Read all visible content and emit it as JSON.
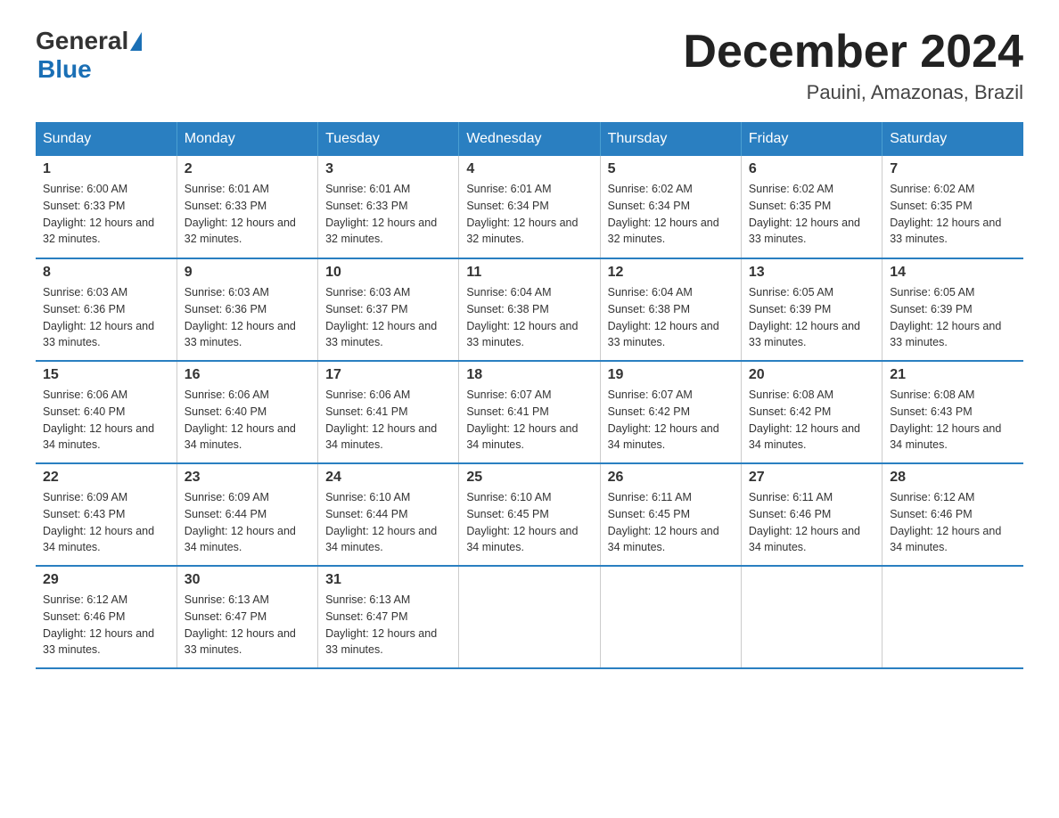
{
  "logo": {
    "general": "General",
    "blue": "Blue",
    "underline": "Blue"
  },
  "header": {
    "month_title": "December 2024",
    "location": "Pauini, Amazonas, Brazil"
  },
  "weekdays": [
    "Sunday",
    "Monday",
    "Tuesday",
    "Wednesday",
    "Thursday",
    "Friday",
    "Saturday"
  ],
  "weeks": [
    [
      {
        "day": "1",
        "sunrise": "6:00 AM",
        "sunset": "6:33 PM",
        "daylight": "12 hours and 32 minutes."
      },
      {
        "day": "2",
        "sunrise": "6:01 AM",
        "sunset": "6:33 PM",
        "daylight": "12 hours and 32 minutes."
      },
      {
        "day": "3",
        "sunrise": "6:01 AM",
        "sunset": "6:33 PM",
        "daylight": "12 hours and 32 minutes."
      },
      {
        "day": "4",
        "sunrise": "6:01 AM",
        "sunset": "6:34 PM",
        "daylight": "12 hours and 32 minutes."
      },
      {
        "day": "5",
        "sunrise": "6:02 AM",
        "sunset": "6:34 PM",
        "daylight": "12 hours and 32 minutes."
      },
      {
        "day": "6",
        "sunrise": "6:02 AM",
        "sunset": "6:35 PM",
        "daylight": "12 hours and 33 minutes."
      },
      {
        "day": "7",
        "sunrise": "6:02 AM",
        "sunset": "6:35 PM",
        "daylight": "12 hours and 33 minutes."
      }
    ],
    [
      {
        "day": "8",
        "sunrise": "6:03 AM",
        "sunset": "6:36 PM",
        "daylight": "12 hours and 33 minutes."
      },
      {
        "day": "9",
        "sunrise": "6:03 AM",
        "sunset": "6:36 PM",
        "daylight": "12 hours and 33 minutes."
      },
      {
        "day": "10",
        "sunrise": "6:03 AM",
        "sunset": "6:37 PM",
        "daylight": "12 hours and 33 minutes."
      },
      {
        "day": "11",
        "sunrise": "6:04 AM",
        "sunset": "6:38 PM",
        "daylight": "12 hours and 33 minutes."
      },
      {
        "day": "12",
        "sunrise": "6:04 AM",
        "sunset": "6:38 PM",
        "daylight": "12 hours and 33 minutes."
      },
      {
        "day": "13",
        "sunrise": "6:05 AM",
        "sunset": "6:39 PM",
        "daylight": "12 hours and 33 minutes."
      },
      {
        "day": "14",
        "sunrise": "6:05 AM",
        "sunset": "6:39 PM",
        "daylight": "12 hours and 33 minutes."
      }
    ],
    [
      {
        "day": "15",
        "sunrise": "6:06 AM",
        "sunset": "6:40 PM",
        "daylight": "12 hours and 34 minutes."
      },
      {
        "day": "16",
        "sunrise": "6:06 AM",
        "sunset": "6:40 PM",
        "daylight": "12 hours and 34 minutes."
      },
      {
        "day": "17",
        "sunrise": "6:06 AM",
        "sunset": "6:41 PM",
        "daylight": "12 hours and 34 minutes."
      },
      {
        "day": "18",
        "sunrise": "6:07 AM",
        "sunset": "6:41 PM",
        "daylight": "12 hours and 34 minutes."
      },
      {
        "day": "19",
        "sunrise": "6:07 AM",
        "sunset": "6:42 PM",
        "daylight": "12 hours and 34 minutes."
      },
      {
        "day": "20",
        "sunrise": "6:08 AM",
        "sunset": "6:42 PM",
        "daylight": "12 hours and 34 minutes."
      },
      {
        "day": "21",
        "sunrise": "6:08 AM",
        "sunset": "6:43 PM",
        "daylight": "12 hours and 34 minutes."
      }
    ],
    [
      {
        "day": "22",
        "sunrise": "6:09 AM",
        "sunset": "6:43 PM",
        "daylight": "12 hours and 34 minutes."
      },
      {
        "day": "23",
        "sunrise": "6:09 AM",
        "sunset": "6:44 PM",
        "daylight": "12 hours and 34 minutes."
      },
      {
        "day": "24",
        "sunrise": "6:10 AM",
        "sunset": "6:44 PM",
        "daylight": "12 hours and 34 minutes."
      },
      {
        "day": "25",
        "sunrise": "6:10 AM",
        "sunset": "6:45 PM",
        "daylight": "12 hours and 34 minutes."
      },
      {
        "day": "26",
        "sunrise": "6:11 AM",
        "sunset": "6:45 PM",
        "daylight": "12 hours and 34 minutes."
      },
      {
        "day": "27",
        "sunrise": "6:11 AM",
        "sunset": "6:46 PM",
        "daylight": "12 hours and 34 minutes."
      },
      {
        "day": "28",
        "sunrise": "6:12 AM",
        "sunset": "6:46 PM",
        "daylight": "12 hours and 34 minutes."
      }
    ],
    [
      {
        "day": "29",
        "sunrise": "6:12 AM",
        "sunset": "6:46 PM",
        "daylight": "12 hours and 33 minutes."
      },
      {
        "day": "30",
        "sunrise": "6:13 AM",
        "sunset": "6:47 PM",
        "daylight": "12 hours and 33 minutes."
      },
      {
        "day": "31",
        "sunrise": "6:13 AM",
        "sunset": "6:47 PM",
        "daylight": "12 hours and 33 minutes."
      },
      null,
      null,
      null,
      null
    ]
  ]
}
